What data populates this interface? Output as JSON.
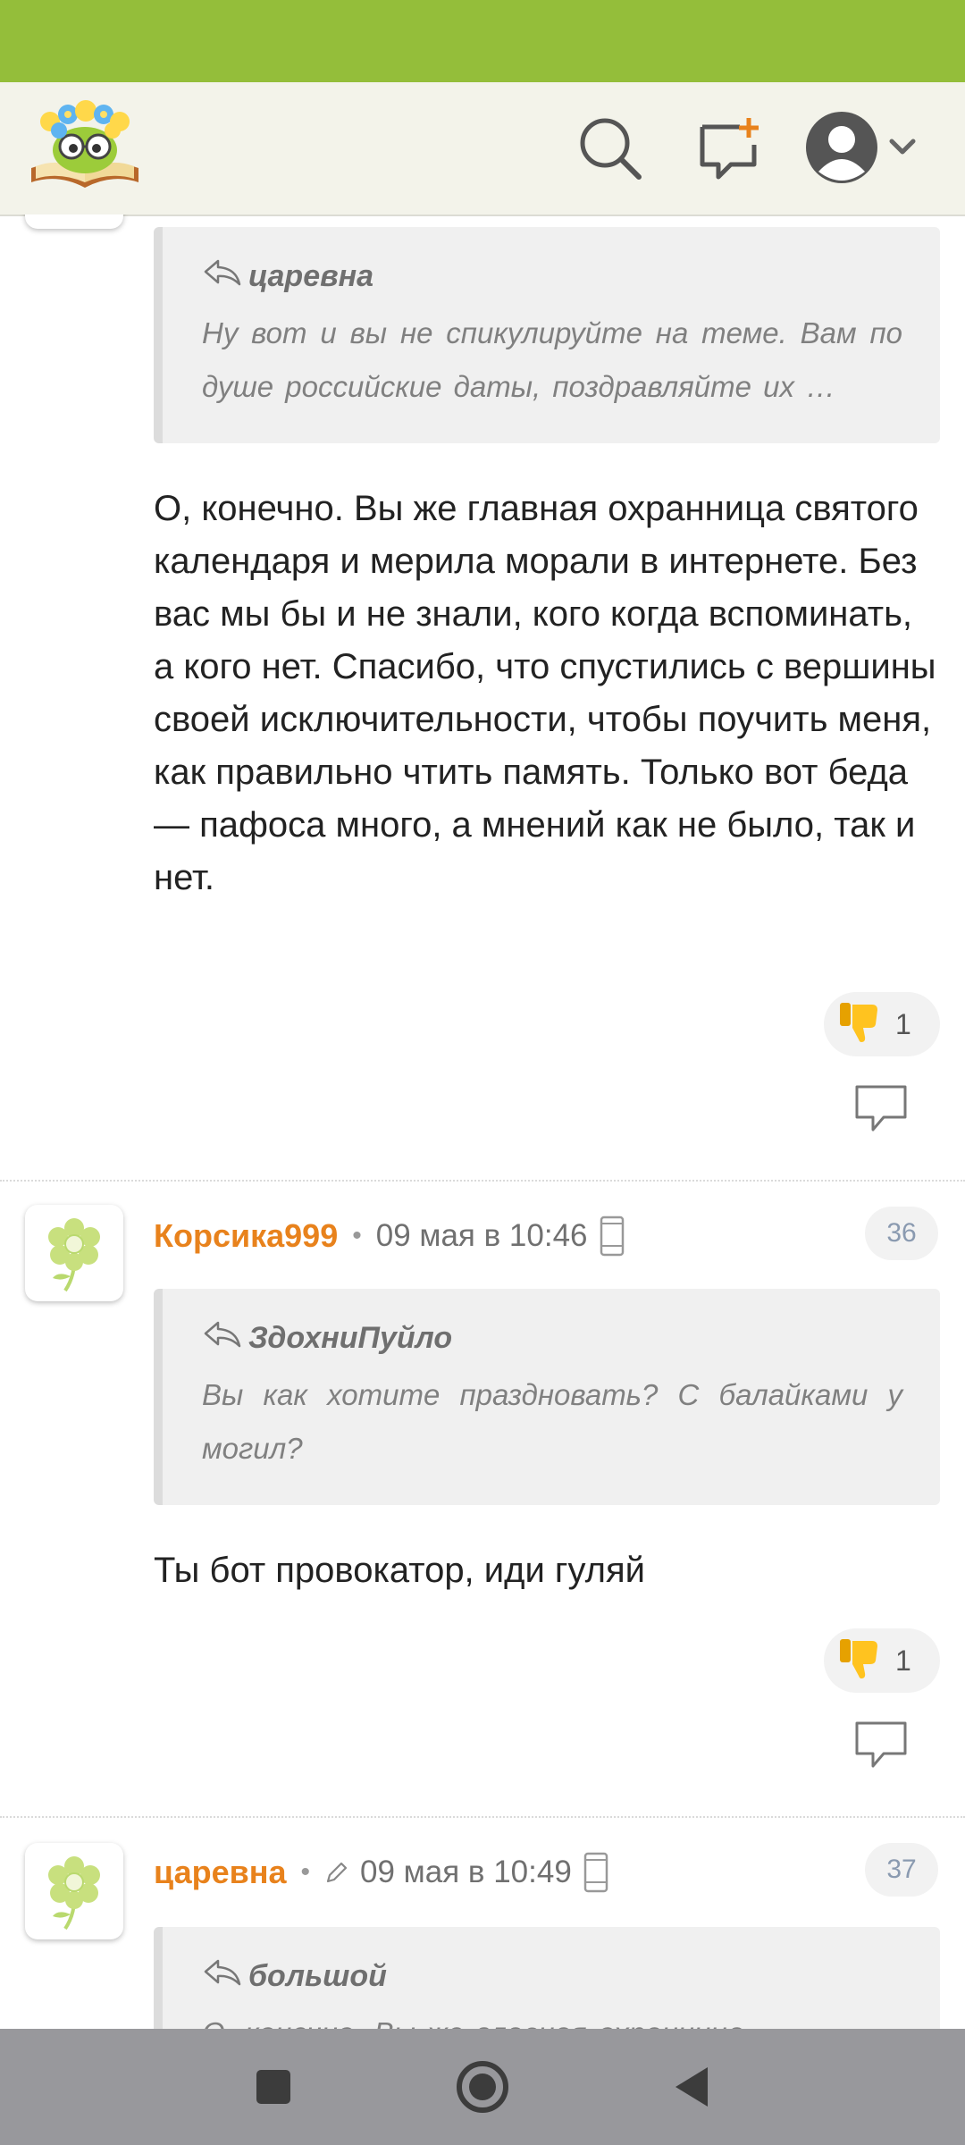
{
  "comments": [
    {
      "quote_author": "царевна",
      "quote_text": "Ну вот и вы не спикулируйте на теме. Вам по душе российские даты, поздравляйте их …",
      "text": "О, конечно. Вы же главная охранница святого календаря и мерила морали в интернете. Без вас мы бы и не знали, кого когда вспоминать, а кого нет. Спасибо, что спустились с вершины своей исключительности, чтобы поучить меня, как правильно чтить память. Только вот беда — пафоса много, а мнений как не было, так и нет.",
      "reaction_count": "1"
    },
    {
      "username": "Корсика999",
      "separator": "•",
      "time": "09 мая в 10:46",
      "number": "36",
      "quote_author": "ЗдохниПуйло",
      "quote_text": "Вы как хотите праздновать? С балайками у могил?",
      "text": "Ты бот провокатор, иди гуляй",
      "reaction_count": "1"
    },
    {
      "username": "царевна",
      "separator": "•",
      "time": "09 мая в 10:49",
      "number": "37",
      "quote_author": "большой",
      "quote_text": "О, конечно. Вы же главная охранница"
    }
  ],
  "colors": {
    "status_bar": "#94be3a",
    "header_bg": "#f3f3ea",
    "username": "#e8821c",
    "nav_bar": "#98989c"
  },
  "icons": [
    "logo-icon",
    "search-icon",
    "new-post-icon",
    "user-avatar-icon",
    "chevron-down-icon",
    "reply-arrow-icon",
    "thumbs-down-icon",
    "reply-bubble-icon",
    "flower-avatar-icon",
    "mobile-device-icon",
    "pencil-icon",
    "nav-square-icon",
    "nav-circle-icon",
    "nav-back-icon"
  ]
}
